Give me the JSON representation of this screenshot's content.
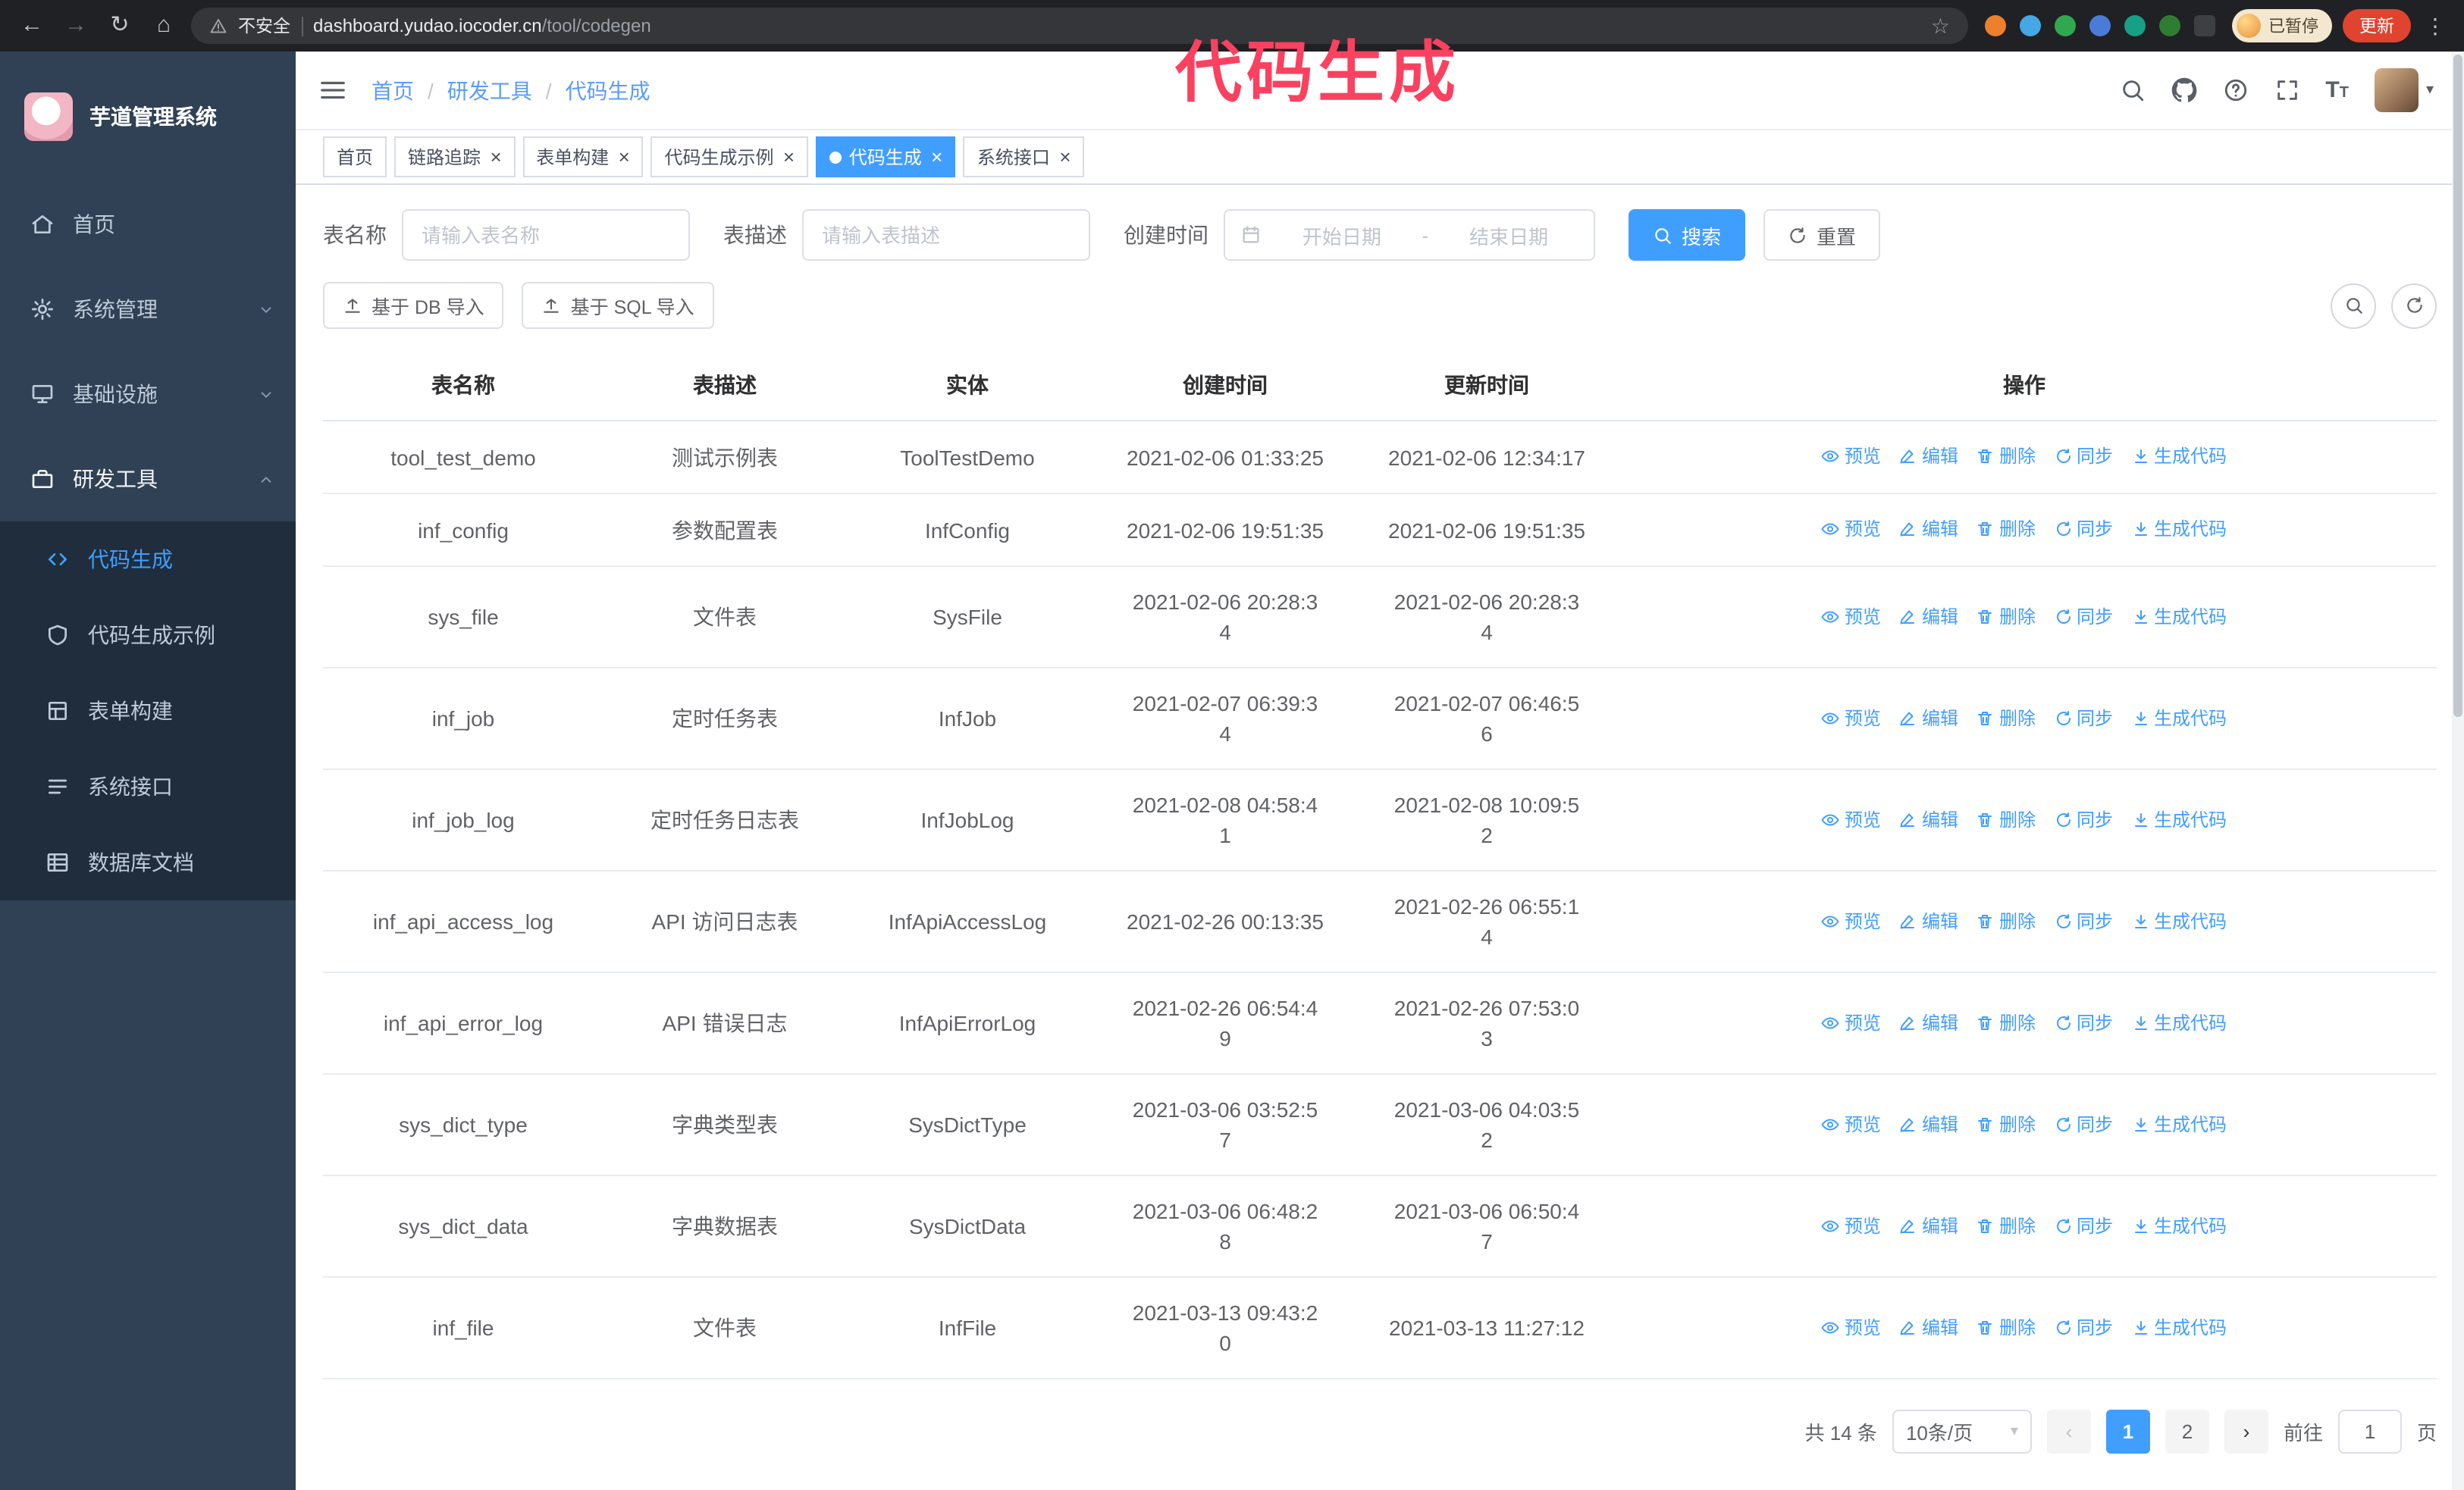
{
  "annotation": {
    "text": "代码生成",
    "color": "#fb4160"
  },
  "browser": {
    "security_label": "不安全",
    "url_host": "dashboard.yudao.iocoder.cn",
    "url_path": "/tool/codegen",
    "profile_badge": "已暂停",
    "update_button": "更新",
    "extensions": [
      {
        "name": "extension-icon",
        "color": "#ee7f2d",
        "shape": "round"
      },
      {
        "name": "extension-icon",
        "color": "#45a7e6",
        "shape": "round"
      },
      {
        "name": "extension-icon",
        "color": "#2fa84f",
        "shape": "round"
      },
      {
        "name": "extension-icon",
        "color": "#4a7bd8",
        "shape": "round"
      },
      {
        "name": "extension-icon",
        "color": "#16a085",
        "shape": "round"
      },
      {
        "name": "extension-icon",
        "color": "#2e7d32",
        "shape": "round"
      },
      {
        "name": "extension-icon",
        "color": "#3c4043",
        "shape": "square"
      }
    ]
  },
  "sidebar": {
    "app_title": "芋道管理系统",
    "items": [
      {
        "label": "首页"
      },
      {
        "label": "系统管理"
      },
      {
        "label": "基础设施"
      },
      {
        "label": "研发工具"
      }
    ],
    "subitems": [
      {
        "label": "代码生成"
      },
      {
        "label": "代码生成示例"
      },
      {
        "label": "表单构建"
      },
      {
        "label": "系统接口"
      },
      {
        "label": "数据库文档"
      }
    ]
  },
  "breadcrumb": [
    "首页",
    "研发工具",
    "代码生成"
  ],
  "tags": [
    {
      "label": "首页",
      "closable": false,
      "active": false
    },
    {
      "label": "链路追踪",
      "closable": true,
      "active": false
    },
    {
      "label": "表单构建",
      "closable": true,
      "active": false
    },
    {
      "label": "代码生成示例",
      "closable": true,
      "active": false
    },
    {
      "label": "代码生成",
      "closable": true,
      "active": true
    },
    {
      "label": "系统接口",
      "closable": true,
      "active": false
    }
  ],
  "filters": {
    "name_label": "表名称",
    "name_placeholder": "请输入表名称",
    "desc_label": "表描述",
    "desc_placeholder": "请输入表描述",
    "time_label": "创建时间",
    "start_placeholder": "开始日期",
    "end_placeholder": "结束日期",
    "range_separator": "-",
    "search_button": "搜索",
    "reset_button": "重置",
    "import_db_button": "基于 DB 导入",
    "import_sql_button": "基于 SQL 导入"
  },
  "table": {
    "headers": [
      "表名称",
      "表描述",
      "实体",
      "创建时间",
      "更新时间",
      "操作"
    ],
    "ops": [
      {
        "label": "预览",
        "icon": "eye-icon",
        "name": "preview"
      },
      {
        "label": "编辑",
        "icon": "edit-icon",
        "name": "edit"
      },
      {
        "label": "删除",
        "icon": "delete-icon",
        "name": "delete"
      },
      {
        "label": "同步",
        "icon": "sync-icon",
        "name": "sync"
      },
      {
        "label": "生成代码",
        "icon": "download-icon",
        "name": "generate"
      }
    ],
    "rows": [
      {
        "name": "tool_test_demo",
        "desc": "测试示例表",
        "entity": "ToolTestDemo",
        "created": "2021-02-06 01:33:25",
        "updated": "2021-02-06 12:34:17"
      },
      {
        "name": "inf_config",
        "desc": "参数配置表",
        "entity": "InfConfig",
        "created": "2021-02-06 19:51:35",
        "updated": "2021-02-06 19:51:35"
      },
      {
        "name": "sys_file",
        "desc": "文件表",
        "entity": "SysFile",
        "created": "2021-02-06 20:28:3\n4",
        "updated": "2021-02-06 20:28:3\n4"
      },
      {
        "name": "inf_job",
        "desc": "定时任务表",
        "entity": "InfJob",
        "created": "2021-02-07 06:39:3\n4",
        "updated": "2021-02-07 06:46:5\n6"
      },
      {
        "name": "inf_job_log",
        "desc": "定时任务日志表",
        "entity": "InfJobLog",
        "created": "2021-02-08 04:58:4\n1",
        "updated": "2021-02-08 10:09:5\n2"
      },
      {
        "name": "inf_api_access_log",
        "desc": "API 访问日志表",
        "entity": "InfApiAccessLog",
        "created": "2021-02-26 00:13:35",
        "updated": "2021-02-26 06:55:1\n4"
      },
      {
        "name": "inf_api_error_log",
        "desc": "API 错误日志",
        "entity": "InfApiErrorLog",
        "created": "2021-02-26 06:54:4\n9",
        "updated": "2021-02-26 07:53:0\n3"
      },
      {
        "name": "sys_dict_type",
        "desc": "字典类型表",
        "entity": "SysDictType",
        "created": "2021-03-06 03:52:5\n7",
        "updated": "2021-03-06 04:03:5\n2"
      },
      {
        "name": "sys_dict_data",
        "desc": "字典数据表",
        "entity": "SysDictData",
        "created": "2021-03-06 06:48:2\n8",
        "updated": "2021-03-06 06:50:4\n7"
      },
      {
        "name": "inf_file",
        "desc": "文件表",
        "entity": "InfFile",
        "created": "2021-03-13 09:43:2\n0",
        "updated": "2021-03-13 11:27:12"
      }
    ]
  },
  "pagination": {
    "total_text": "共 14 条",
    "page_size": "10条/页",
    "pages": [
      {
        "label": "1",
        "active": true
      },
      {
        "label": "2",
        "active": false
      }
    ],
    "goto_label": "前往",
    "goto_value": "1",
    "goto_suffix": "页"
  },
  "colors": {
    "accent": "#409eff",
    "sidebar_bg": "#304156",
    "submenu_bg": "#1f2d3d",
    "annotation": "#fb4160",
    "update_button": "#e0432e"
  }
}
